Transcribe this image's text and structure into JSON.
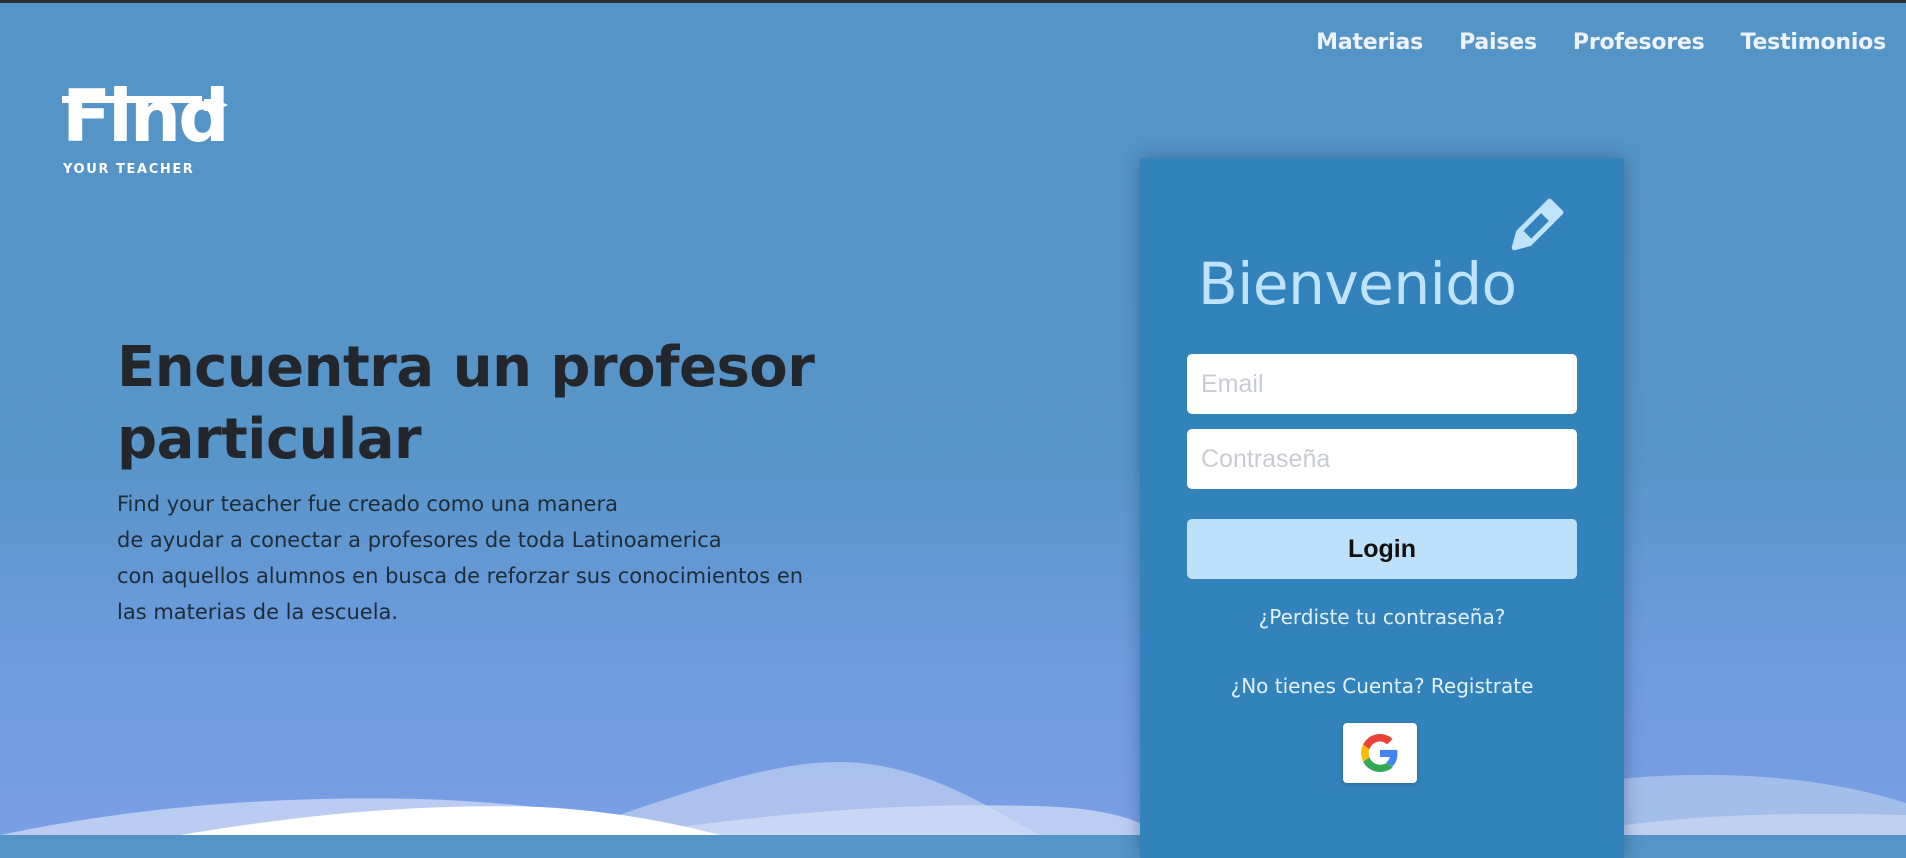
{
  "nav": {
    "items": [
      {
        "label": "Materias"
      },
      {
        "label": "Paises"
      },
      {
        "label": "Profesores"
      },
      {
        "label": "Testimonios"
      }
    ]
  },
  "logo": {
    "word": "Find",
    "subtitle": "YOUR TEACHER"
  },
  "hero": {
    "title": "Encuentra un profesor particular",
    "description_lines": [
      "Find your teacher fue creado como una manera",
      "de ayudar a conectar a profesores de toda Latinoamerica",
      "con aquellos alumnos en busca de reforzar sus conocimientos en",
      "las materias de la escuela."
    ]
  },
  "login_card": {
    "title": "Bienvenido",
    "email_placeholder": "Email",
    "password_placeholder": "Contraseña",
    "login_label": "Login",
    "forgot_link": "¿Perdiste tu contraseña?",
    "register_link": "¿No tienes Cuenta? Registrate",
    "google_icon": "google-icon"
  },
  "colors": {
    "background_top": "#5494c6",
    "background_bottom": "#7a9ee6",
    "card": "#3282bc",
    "title_light": "#bfe3fb",
    "login_button": "#bde0fb"
  }
}
